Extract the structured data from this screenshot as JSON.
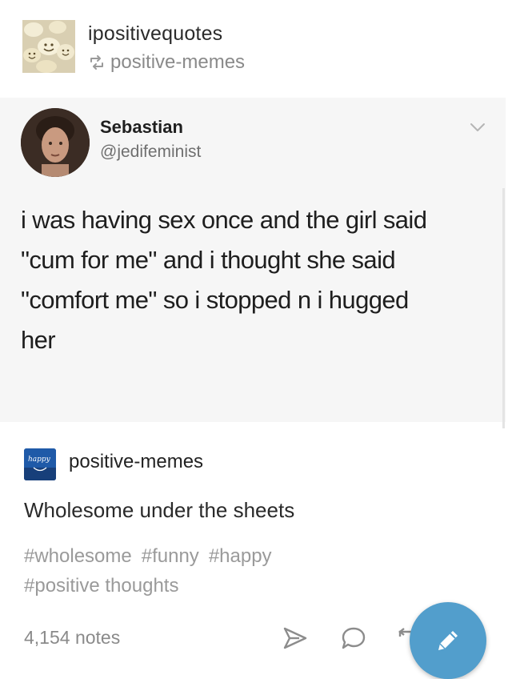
{
  "post": {
    "blog_name": "ipositivequotes",
    "reblogged_from": "positive-memes",
    "blog_avatar_icon": "smiley-pills-icon",
    "reblog_icon": "reblog-icon"
  },
  "tweet": {
    "display_name": "Sebastian",
    "handle": "@jedifeminist",
    "lines": [
      "i was having sex once and the girl said",
      "\"cum for me\" and i thought she said",
      "\"comfort me\" so i stopped n i hugged",
      "her"
    ],
    "menu_icon": "chevron-down-icon"
  },
  "source": {
    "blog_name": "positive-memes",
    "avatar_text": "happy",
    "caption": "Wholesome under the sheets",
    "tags": [
      "#wholesome",
      "#funny",
      "#happy",
      "#positive thoughts"
    ]
  },
  "footer": {
    "notes": "4,154 notes",
    "share_icon": "send-icon",
    "reply_icon": "reply-bubble-icon",
    "reblog_icon": "reblog-icon",
    "compose_icon": "pencil-icon",
    "accent": "#529ecc"
  }
}
